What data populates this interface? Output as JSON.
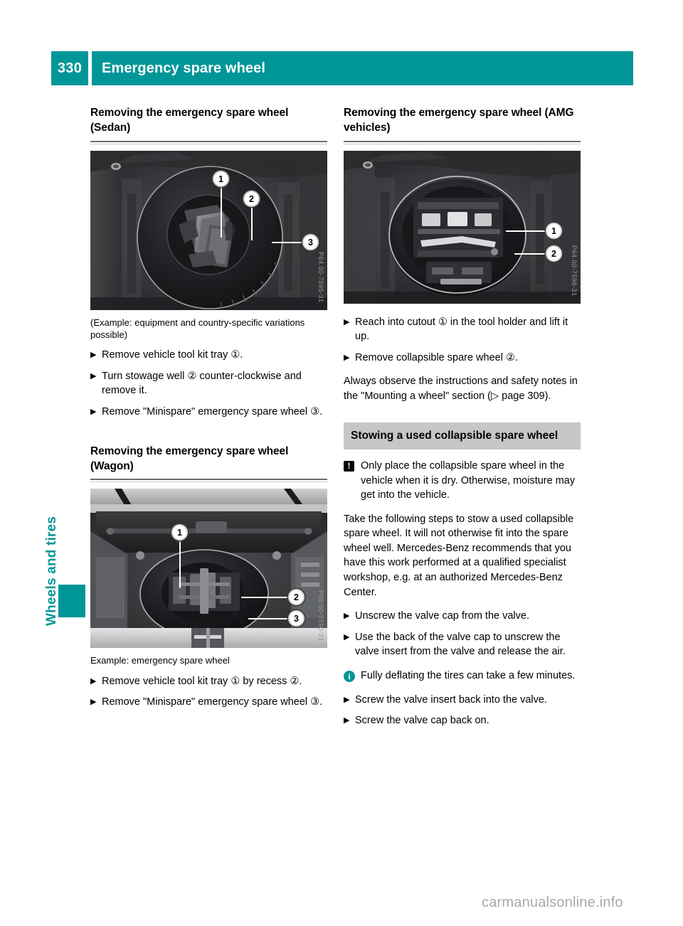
{
  "header": {
    "page_number": "330",
    "title": "Emergency spare wheel"
  },
  "side_tab": {
    "label": "Wheels and tires"
  },
  "colors": {
    "teal": "#009698",
    "gray_heading_bg": "#c6c6c6",
    "rule": "#6e6e6e",
    "watermark": "#a8a8a8"
  },
  "left_column": {
    "section1": {
      "heading": "Removing the emergency spare wheel (Sedan)",
      "figure": {
        "name": "sedan-spare-wheel-well-photo",
        "code": "P64.00-7595-31",
        "callouts": [
          "1",
          "2",
          "3"
        ]
      },
      "caption": "(Example: equipment and country-specific variations possible)",
      "steps": [
        "Remove vehicle tool kit tray ①.",
        "Turn stowage well ② counter-clockwise and remove it.",
        "Remove \"Minispare\" emergency spare wheel ③."
      ]
    },
    "section2": {
      "heading": "Removing the emergency spare wheel (Wagon)",
      "figure": {
        "name": "wagon-spare-wheel-well-photo",
        "code": "P68.00-7590-31",
        "callouts": [
          "1",
          "2",
          "3"
        ]
      },
      "caption": "Example: emergency spare wheel",
      "steps": [
        "Remove vehicle tool kit tray ① by recess ②.",
        "Remove \"Minispare\" emergency spare wheel ③."
      ]
    }
  },
  "right_column": {
    "section1": {
      "heading": "Removing the emergency spare wheel (AMG vehicles)",
      "figure": {
        "name": "amg-spare-wheel-well-photo",
        "code": "P64.00-7598-31",
        "callouts": [
          "1",
          "2"
        ]
      },
      "steps": [
        "Reach into cutout ① in the tool holder and lift it up.",
        "Remove collapsible spare wheel ②."
      ],
      "note": "Always observe the instructions and safety notes in the \"Mounting a wheel\" section (▷ page 309)."
    },
    "section2": {
      "heading": "Stowing a used collapsible spare wheel",
      "warning": {
        "icon": "warning-icon",
        "text": "Only place the collapsible spare wheel in the vehicle when it is dry. Otherwise, moisture may get into the vehicle."
      },
      "paragraph": "Take the following steps to stow a used collapsible spare wheel. It will not otherwise fit into the spare wheel well. Mercedes-Benz recommends that you have this work performed at a qualified specialist workshop, e.g. at an authorized Mercedes-Benz Center.",
      "steps_before": [
        "Unscrew the valve cap from the valve.",
        "Use the back of the valve cap to unscrew the valve insert from the valve and release the air."
      ],
      "info": {
        "icon": "info-icon",
        "text": "Fully deflating the tires can take a few minutes."
      },
      "steps_after": [
        "Screw the valve insert back into the valve.",
        "Screw the valve cap back on."
      ]
    }
  },
  "footer": {
    "watermark": "carmanualsonline.info"
  }
}
